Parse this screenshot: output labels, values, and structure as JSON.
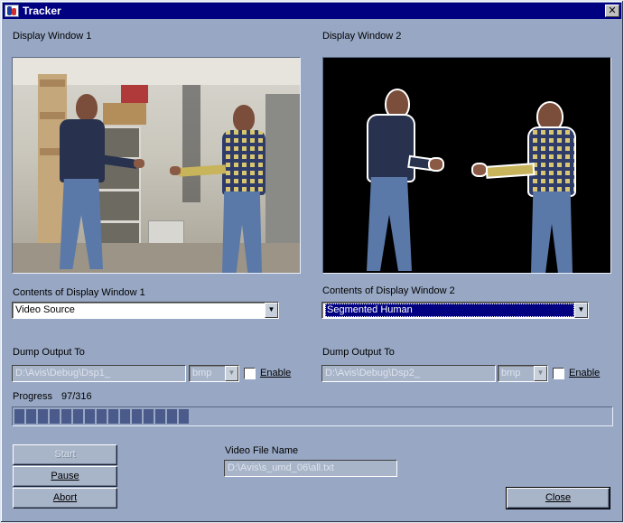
{
  "window": {
    "title": "Tracker",
    "close_glyph": "✕"
  },
  "display1": {
    "label": "Display Window 1",
    "contents_label": "Contents of Display Window 1",
    "contents_value": "Video Source",
    "dump_label": "Dump Output To",
    "dump_path": "D:\\Avis\\Debug\\Dsp1_",
    "dump_format": "bmp",
    "enable_label": "Enable",
    "enable_checked": false
  },
  "display2": {
    "label": "Display Window 2",
    "contents_label": "Contents of Display Window 2",
    "contents_value": "Segmented Human",
    "dump_label": "Dump Output To",
    "dump_path": "D:\\Avis\\Debug\\Dsp2_",
    "dump_format": "bmp",
    "enable_label": "Enable",
    "enable_checked": false
  },
  "progress": {
    "label": "Progress",
    "value_text": "97/316",
    "current": 97,
    "total": 316
  },
  "video_file": {
    "label": "Video File Name",
    "value": "D:\\Avis\\s_umd_06\\all.txt"
  },
  "buttons": {
    "start": "Start",
    "pause": "Pause",
    "abort": "Abort",
    "close": "Close"
  },
  "icons": {
    "app": "tracker-app-icon",
    "close": "close-icon",
    "dropdown": "chevron-down-icon"
  }
}
